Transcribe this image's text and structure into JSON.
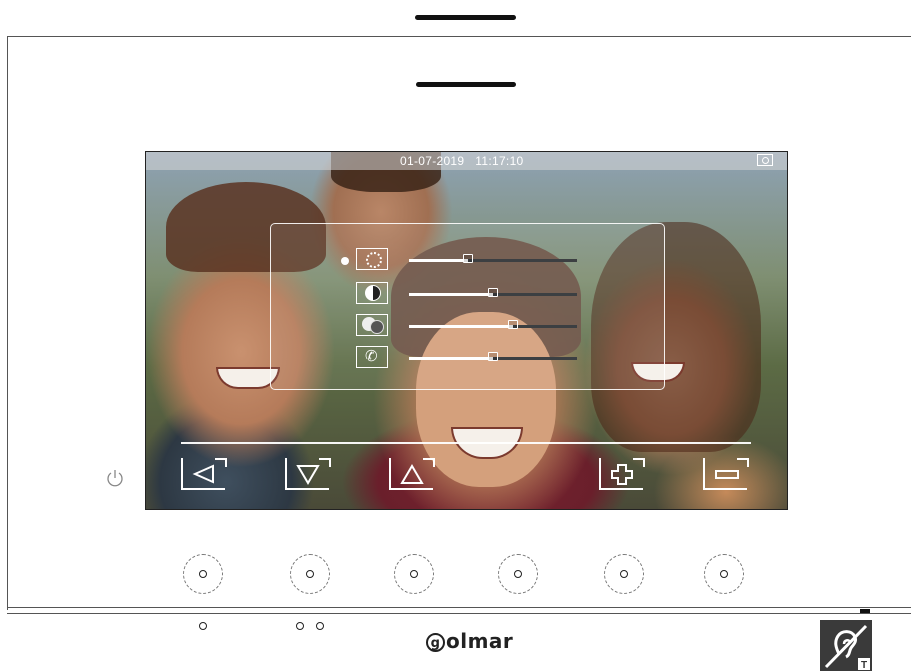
{
  "status_bar": {
    "date": "01-07-2019",
    "time": "11:17:10",
    "monitor_icon": "camera-monitor-icon"
  },
  "settings_panel": {
    "rows": [
      {
        "icon": "brightness-icon",
        "level": 0.35,
        "selected": true
      },
      {
        "icon": "contrast-icon",
        "level": 0.5,
        "selected": false
      },
      {
        "icon": "color-icon",
        "level": 0.62,
        "selected": false
      },
      {
        "icon": "call-volume-icon",
        "level": 0.5,
        "selected": false
      }
    ]
  },
  "softkeys": [
    {
      "name": "back",
      "icon": "triangle-left-icon"
    },
    {
      "name": "down",
      "icon": "triangle-down-icon"
    },
    {
      "name": "up",
      "icon": "triangle-up-icon"
    },
    {
      "name": "plus",
      "icon": "plus-icon"
    },
    {
      "name": "minus",
      "icon": "minus-icon"
    }
  ],
  "brand": {
    "logo_glyph": "g",
    "logo_text": "olmar"
  },
  "icons": {
    "power": "power-icon",
    "hearing_loop": "hearing-loop-t-icon"
  },
  "colors": {
    "panel_border": "#ffffff",
    "slider_fill": "#ffffff",
    "slider_track": "#3c3f42"
  }
}
